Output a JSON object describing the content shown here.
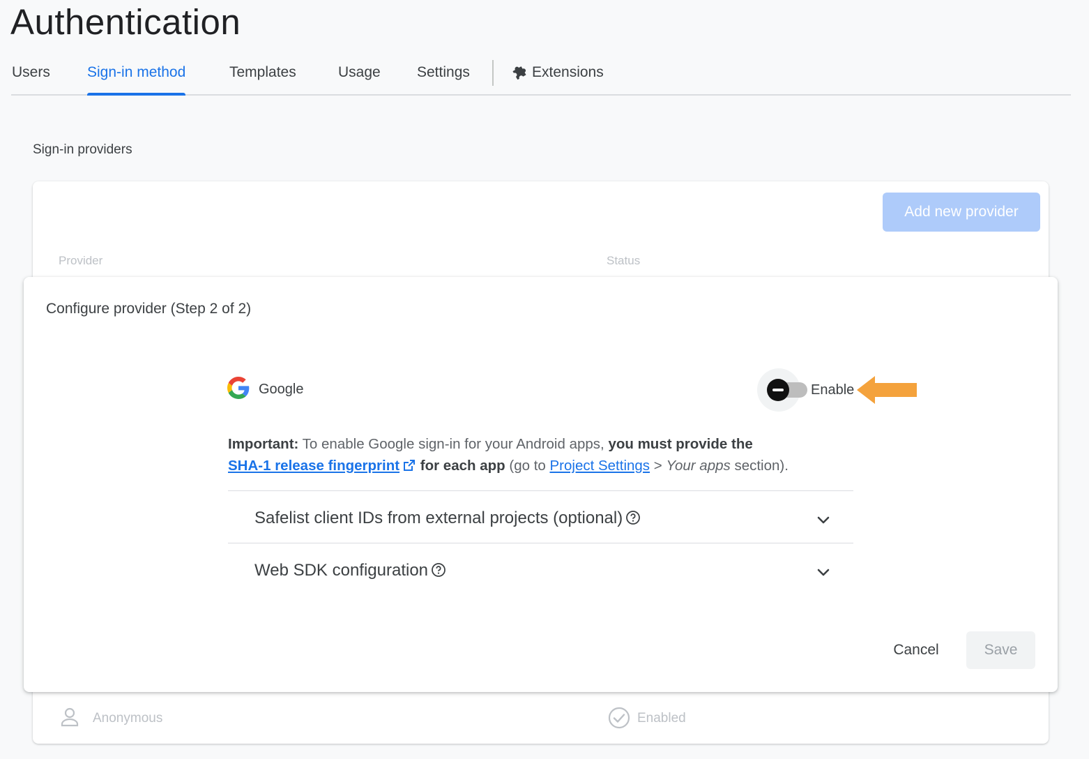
{
  "page": {
    "title": "Authentication"
  },
  "tabs": [
    {
      "label": "Users"
    },
    {
      "label": "Sign-in method",
      "active": true
    },
    {
      "label": "Templates"
    },
    {
      "label": "Usage"
    },
    {
      "label": "Settings"
    },
    {
      "label": "Extensions",
      "icon": "puzzle-icon"
    }
  ],
  "providers": {
    "heading": "Sign-in providers",
    "add_button": "Add new provider",
    "columns": {
      "provider": "Provider",
      "status": "Status"
    },
    "rows": [
      {
        "name": "Anonymous",
        "status": "Enabled",
        "icon": "person-icon",
        "status_icon": "check-circle-icon"
      }
    ]
  },
  "config": {
    "title": "Configure provider (Step 2 of 2)",
    "provider_name": "Google",
    "enable_label": "Enable",
    "info": {
      "important": "Important:",
      "text1": " To enable Google sign-in for your Android apps, ",
      "bold1": "you must provide the",
      "link1": "SHA-1 release fingerprint",
      "bold2": " for each app",
      "text2": " (go to ",
      "link2": "Project Settings",
      "text3": " > ",
      "italic": "Your apps",
      "text4": " section)."
    },
    "accordions": [
      {
        "label": "Safelist client IDs from external projects (optional)"
      },
      {
        "label": "Web SDK configuration"
      }
    ],
    "cancel_label": "Cancel",
    "save_label": "Save"
  },
  "colors": {
    "accent": "#1a73e8",
    "arrow": "#f4a23c"
  }
}
